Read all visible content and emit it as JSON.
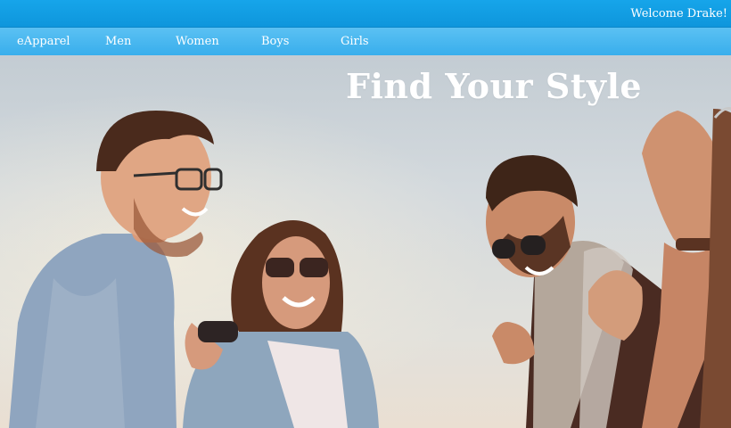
{
  "header": {
    "welcome_text": "Welcome Drake!"
  },
  "nav": {
    "brand": "eApparel",
    "items": [
      {
        "label": "Men"
      },
      {
        "label": "Women"
      },
      {
        "label": "Boys"
      },
      {
        "label": "Girls"
      }
    ]
  },
  "hero": {
    "title": "Find Your Style",
    "image": "group-of-friends-photo"
  },
  "colors": {
    "topbar": "#16a5ea",
    "navbar": "#49b8f0",
    "text": "#ffffff"
  }
}
